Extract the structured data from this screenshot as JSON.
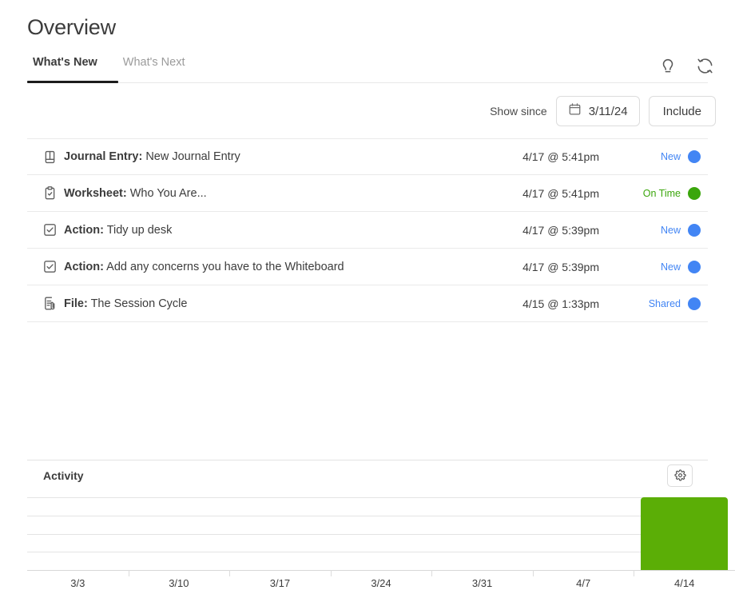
{
  "header": {
    "title": "Overview",
    "icons": [
      {
        "name": "lightbulb-icon"
      },
      {
        "name": "refresh-icon"
      }
    ]
  },
  "tabs": [
    {
      "label": "What's New",
      "active": true
    },
    {
      "label": "What's Next",
      "active": false
    }
  ],
  "filters": {
    "show_since_label": "Show since",
    "date_value": "3/11/24",
    "calendar_icon": "calendar-icon",
    "include_label": "Include"
  },
  "feed": {
    "rows": [
      {
        "icon": "journal-book-icon",
        "kind": "Journal Entry:",
        "title": "New Journal Entry",
        "time": "4/17 @ 5:41pm",
        "status": "New",
        "status_color": "#4285f4"
      },
      {
        "icon": "clipboard-check-icon",
        "kind": "Worksheet:",
        "title": "Who You Are...",
        "time": "4/17 @ 5:41pm",
        "status": "On Time",
        "status_color": "#3ba60c"
      },
      {
        "icon": "checkbox-check-icon",
        "kind": "Action:",
        "title": "Tidy up desk",
        "time": "4/17 @ 5:39pm",
        "status": "New",
        "status_color": "#4285f4"
      },
      {
        "icon": "checkbox-check-icon",
        "kind": "Action:",
        "title": "Add any concerns you have to the Whiteboard",
        "time": "4/17 @ 5:39pm",
        "status": "New",
        "status_color": "#4285f4"
      },
      {
        "icon": "file-attachment-icon",
        "kind": "File:",
        "title": "The Session Cycle",
        "time": "4/15 @ 1:33pm",
        "status": "Shared",
        "status_color": "#4285f4"
      }
    ]
  },
  "activity": {
    "title": "Activity",
    "settings_icon": "gear-icon"
  },
  "chart_data": {
    "type": "bar",
    "title": "Activity",
    "xlabel": "",
    "ylabel": "",
    "categories": [
      "3/3",
      "3/10",
      "3/17",
      "3/24",
      "3/31",
      "4/7",
      "4/14"
    ],
    "values": [
      0,
      0,
      0,
      0,
      0,
      0,
      4
    ],
    "ylim": [
      0,
      4.4
    ],
    "grid": true,
    "gridlines": [
      1,
      2,
      3,
      4
    ],
    "legend": "none",
    "bar_color": "#5bae06"
  }
}
